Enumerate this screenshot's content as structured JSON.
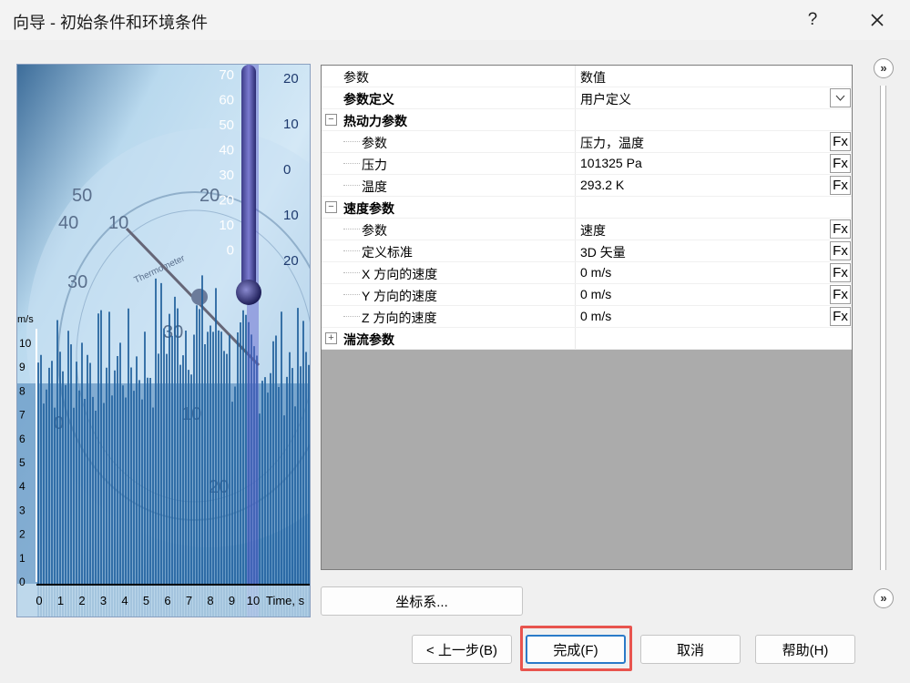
{
  "window": {
    "title": "向导 - 初始条件和环境条件",
    "help_glyph": "?",
    "close_glyph": "✕"
  },
  "grid": {
    "header": {
      "name": "参数",
      "value": "数值"
    },
    "param_def": {
      "name": "参数定义",
      "value": "用户定义"
    },
    "groups": [
      {
        "name": "热动力参数",
        "expander": "−",
        "rows": [
          {
            "name": "参数",
            "value": "压力，温度"
          },
          {
            "name": "压力",
            "value": "101325 Pa"
          },
          {
            "name": "温度",
            "value": "293.2 K"
          }
        ]
      },
      {
        "name": "速度参数",
        "expander": "−",
        "rows": [
          {
            "name": "参数",
            "value": "速度"
          },
          {
            "name": "定义标准",
            "value": "3D 矢量"
          },
          {
            "name": "X 方向的速度",
            "value": "0 m/s"
          },
          {
            "name": "Y 方向的速度",
            "value": "0 m/s"
          },
          {
            "name": "Z 方向的速度",
            "value": "0 m/s"
          }
        ]
      },
      {
        "name": "湍流参数",
        "expander": "+",
        "rows": []
      }
    ],
    "fx_label": "Fx"
  },
  "illustration": {
    "x_ticks": [
      "0",
      "1",
      "2",
      "3",
      "4",
      "5",
      "6",
      "7",
      "8",
      "9",
      "10"
    ],
    "x_label": "Time, s",
    "y_ticks": [
      "0",
      "1",
      "2",
      "3",
      "4",
      "5",
      "6",
      "7",
      "8",
      "9",
      "10"
    ],
    "y_label": "m/s",
    "thermo_left": [
      "70",
      "60",
      "50",
      "40",
      "30",
      "20",
      "10",
      "0"
    ],
    "thermo_right": [
      "20",
      "10",
      "0",
      "10",
      "20"
    ],
    "dial_numbers": [
      "50",
      "40",
      "30",
      "20",
      "10",
      "0",
      "10",
      "20",
      "30"
    ],
    "dial_word": "Thermometer"
  },
  "buttons": {
    "coord": "坐标系...",
    "prev": "< 上一步(B)",
    "finish": "完成(F)",
    "cancel": "取消",
    "help": "帮助(H)"
  },
  "scroll": {
    "glyph": "»"
  },
  "colors": {
    "accent": "#2a7ac8",
    "highlight": "#e8544e",
    "grid_empty": "#ababab"
  }
}
